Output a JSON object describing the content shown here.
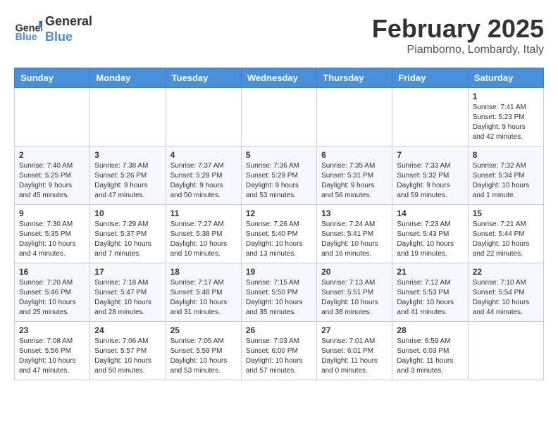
{
  "header": {
    "logo_line1": "General",
    "logo_line2": "Blue",
    "month": "February 2025",
    "location": "Piamborno, Lombardy, Italy"
  },
  "weekdays": [
    "Sunday",
    "Monday",
    "Tuesday",
    "Wednesday",
    "Thursday",
    "Friday",
    "Saturday"
  ],
  "weeks": [
    [
      {
        "day": "",
        "info": ""
      },
      {
        "day": "",
        "info": ""
      },
      {
        "day": "",
        "info": ""
      },
      {
        "day": "",
        "info": ""
      },
      {
        "day": "",
        "info": ""
      },
      {
        "day": "",
        "info": ""
      },
      {
        "day": "1",
        "info": "Sunrise: 7:41 AM\nSunset: 5:23 PM\nDaylight: 9 hours\nand 42 minutes."
      }
    ],
    [
      {
        "day": "2",
        "info": "Sunrise: 7:40 AM\nSunset: 5:25 PM\nDaylight: 9 hours\nand 45 minutes."
      },
      {
        "day": "3",
        "info": "Sunrise: 7:38 AM\nSunset: 5:26 PM\nDaylight: 9 hours\nand 47 minutes."
      },
      {
        "day": "4",
        "info": "Sunrise: 7:37 AM\nSunset: 5:28 PM\nDaylight: 9 hours\nand 50 minutes."
      },
      {
        "day": "5",
        "info": "Sunrise: 7:36 AM\nSunset: 5:29 PM\nDaylight: 9 hours\nand 53 minutes."
      },
      {
        "day": "6",
        "info": "Sunrise: 7:35 AM\nSunset: 5:31 PM\nDaylight: 9 hours\nand 56 minutes."
      },
      {
        "day": "7",
        "info": "Sunrise: 7:33 AM\nSunset: 5:32 PM\nDaylight: 9 hours\nand 59 minutes."
      },
      {
        "day": "8",
        "info": "Sunrise: 7:32 AM\nSunset: 5:34 PM\nDaylight: 10 hours\nand 1 minute."
      }
    ],
    [
      {
        "day": "9",
        "info": "Sunrise: 7:30 AM\nSunset: 5:35 PM\nDaylight: 10 hours\nand 4 minutes."
      },
      {
        "day": "10",
        "info": "Sunrise: 7:29 AM\nSunset: 5:37 PM\nDaylight: 10 hours\nand 7 minutes."
      },
      {
        "day": "11",
        "info": "Sunrise: 7:27 AM\nSunset: 5:38 PM\nDaylight: 10 hours\nand 10 minutes."
      },
      {
        "day": "12",
        "info": "Sunrise: 7:26 AM\nSunset: 5:40 PM\nDaylight: 10 hours\nand 13 minutes."
      },
      {
        "day": "13",
        "info": "Sunrise: 7:24 AM\nSunset: 5:41 PM\nDaylight: 10 hours\nand 16 minutes."
      },
      {
        "day": "14",
        "info": "Sunrise: 7:23 AM\nSunset: 5:43 PM\nDaylight: 10 hours\nand 19 minutes."
      },
      {
        "day": "15",
        "info": "Sunrise: 7:21 AM\nSunset: 5:44 PM\nDaylight: 10 hours\nand 22 minutes."
      }
    ],
    [
      {
        "day": "16",
        "info": "Sunrise: 7:20 AM\nSunset: 5:46 PM\nDaylight: 10 hours\nand 25 minutes."
      },
      {
        "day": "17",
        "info": "Sunrise: 7:18 AM\nSunset: 5:47 PM\nDaylight: 10 hours\nand 28 minutes."
      },
      {
        "day": "18",
        "info": "Sunrise: 7:17 AM\nSunset: 5:48 PM\nDaylight: 10 hours\nand 31 minutes."
      },
      {
        "day": "19",
        "info": "Sunrise: 7:15 AM\nSunset: 5:50 PM\nDaylight: 10 hours\nand 35 minutes."
      },
      {
        "day": "20",
        "info": "Sunrise: 7:13 AM\nSunset: 5:51 PM\nDaylight: 10 hours\nand 38 minutes."
      },
      {
        "day": "21",
        "info": "Sunrise: 7:12 AM\nSunset: 5:53 PM\nDaylight: 10 hours\nand 41 minutes."
      },
      {
        "day": "22",
        "info": "Sunrise: 7:10 AM\nSunset: 5:54 PM\nDaylight: 10 hours\nand 44 minutes."
      }
    ],
    [
      {
        "day": "23",
        "info": "Sunrise: 7:08 AM\nSunset: 5:56 PM\nDaylight: 10 hours\nand 47 minutes."
      },
      {
        "day": "24",
        "info": "Sunrise: 7:06 AM\nSunset: 5:57 PM\nDaylight: 10 hours\nand 50 minutes."
      },
      {
        "day": "25",
        "info": "Sunrise: 7:05 AM\nSunset: 5:59 PM\nDaylight: 10 hours\nand 53 minutes."
      },
      {
        "day": "26",
        "info": "Sunrise: 7:03 AM\nSunset: 6:00 PM\nDaylight: 10 hours\nand 57 minutes."
      },
      {
        "day": "27",
        "info": "Sunrise: 7:01 AM\nSunset: 6:01 PM\nDaylight: 11 hours\nand 0 minutes."
      },
      {
        "day": "28",
        "info": "Sunrise: 6:59 AM\nSunset: 6:03 PM\nDaylight: 11 hours\nand 3 minutes."
      },
      {
        "day": "",
        "info": ""
      }
    ]
  ]
}
